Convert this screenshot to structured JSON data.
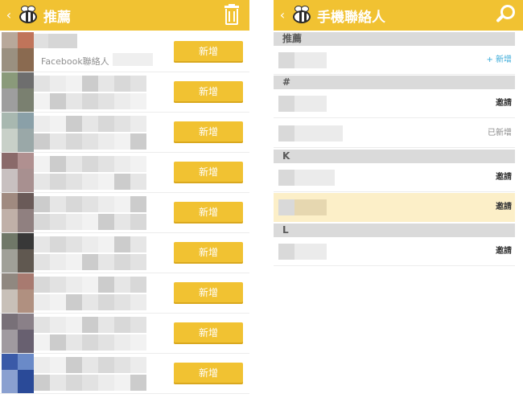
{
  "left_screen": {
    "header": {
      "title": "推薦",
      "back_icon": "‹",
      "action_icon": "trash-icon"
    },
    "first_row_subtitle": "Facebook聯絡人",
    "add_button_label": "新增",
    "rows": [
      {
        "add_label": "新增"
      },
      {
        "add_label": "新增"
      },
      {
        "add_label": "新增"
      },
      {
        "add_label": "新增"
      },
      {
        "add_label": "新增"
      },
      {
        "add_label": "新增"
      },
      {
        "add_label": "新增"
      },
      {
        "add_label": "新增"
      },
      {
        "add_label": "新增"
      }
    ]
  },
  "right_screen": {
    "header": {
      "title": "手機聯絡人",
      "back_icon": "‹",
      "action_icon": "search-icon"
    },
    "sections": [
      {
        "label": "推薦",
        "rows": [
          {
            "status": "+ 新增",
            "status_type": "new"
          }
        ]
      },
      {
        "label": "#",
        "rows": [
          {
            "status": "邀請",
            "status_type": "invite"
          },
          {
            "status": "已新增",
            "status_type": "added"
          }
        ]
      },
      {
        "label": "K",
        "rows": [
          {
            "status": "邀請",
            "status_type": "invite"
          },
          {
            "status": "邀請",
            "status_type": "invite",
            "highlighted": true
          }
        ]
      },
      {
        "label": "L",
        "rows": [
          {
            "status": "邀請",
            "status_type": "invite"
          }
        ]
      }
    ]
  },
  "colors": {
    "accent": "#f1c232",
    "link": "#3aaad8",
    "highlight": "#fcefc8",
    "section": "#dadada"
  }
}
